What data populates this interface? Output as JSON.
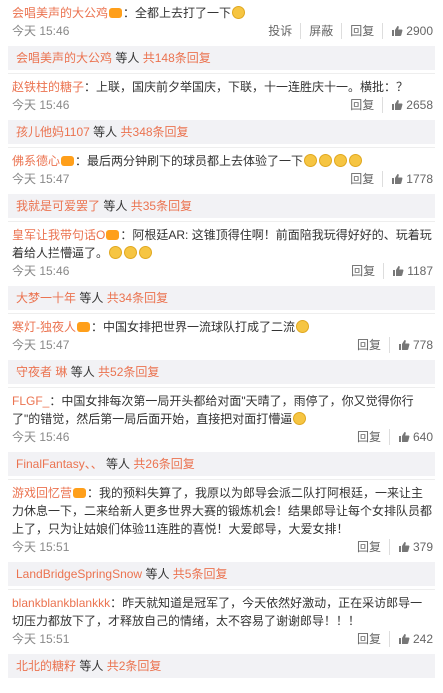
{
  "comments": [
    {
      "user": "会唱美声的大公鸡",
      "text": "全都上去打了一下",
      "time": "今天 15:46",
      "actions": [
        "投诉",
        "屏蔽",
        "回复"
      ],
      "likes": "2900"
    },
    {
      "user": "赵铁柱的糖子",
      "text": "上联，国庆前夕举国庆，下联，十一连胜庆十一。横批：？",
      "time": "今天 15:46",
      "actions": [
        "回复"
      ],
      "likes": "2658"
    },
    {
      "user": "佛系德心",
      "text": "最后两分钟刷下的球员都上去体验了一下",
      "time": "今天 15:47",
      "actions": [
        "回复"
      ],
      "likes": "1778"
    },
    {
      "user": "皇军让我带句话O",
      "text": "阿根廷AR: 这锥顶得住啊！前面陪我玩得好好的、玩着玩着给人拦懵逼了。",
      "time": "今天 15:46",
      "actions": [
        "回复"
      ],
      "likes": "1187"
    },
    {
      "user": "寒灯-独夜人",
      "text": "中国女排把世界一流球队打成了二流",
      "time": "今天 15:47",
      "actions": [
        "回复"
      ],
      "likes": "778"
    },
    {
      "user": "FLGF_",
      "text": "中国女排每次第一局开头都给对面\"天晴了，雨停了，你又觉得你行了\"的错觉，然后第一局后面开始，直接把对面打懵逼",
      "time": "今天 15:46",
      "actions": [
        "回复"
      ],
      "likes": "640"
    },
    {
      "user": "游戏回忆营",
      "text": "我的预料失算了，我原以为郎导会派二队打阿根廷，一来让主力休息一下，二来给新人更多世界大赛的锻炼机会！结果郎导让每个女排队员都上了，只为让姑娘们体验11连胜的喜悦！大爱郎导，大爱女排！",
      "time": "今天 15:51",
      "actions": [
        "回复"
      ],
      "likes": "379"
    },
    {
      "user": "blankblankblankkk",
      "text": "昨天就知道是冠军了，今天依然好激动，正在采访郎导一切压力都放下了，才释放自己的情绪，太不容易了谢谢郎导！！！",
      "time": "今天 15:51",
      "actions": [
        "回复"
      ],
      "likes": "242"
    }
  ],
  "reply_bars": [
    {
      "user": "会唱美声的大公鸡",
      "suffix": "等人",
      "link": "共148条回复"
    },
    {
      "user": "孩儿他妈1107",
      "suffix": "等人",
      "link": "共348条回复"
    },
    {
      "user": "我就是可爱罢了",
      "suffix": "等人",
      "link": "共35条回复"
    },
    {
      "user": "大梦一十年",
      "suffix": "等人",
      "link": "共34条回复"
    },
    {
      "user": "守夜者 琳",
      "suffix": "等人",
      "link": "共52条回复"
    },
    {
      "user": "FinalFantasy、、",
      "suffix": "等人",
      "link": "共26条回复"
    },
    {
      "user": "LandBridgeSpringSnow",
      "suffix": "等人",
      "link": "共5条回复"
    },
    {
      "user": "北北的糖籽",
      "suffix": "等人",
      "link": "共2条回复"
    }
  ],
  "colors": {
    "username": "#eb7350",
    "reply_bg": "#f2f2f5",
    "meta": "#888888"
  },
  "icons": {
    "like": "thumbs-up-icon",
    "emoji": "emoji-icon",
    "vip_badge": "vip-badge-icon"
  }
}
